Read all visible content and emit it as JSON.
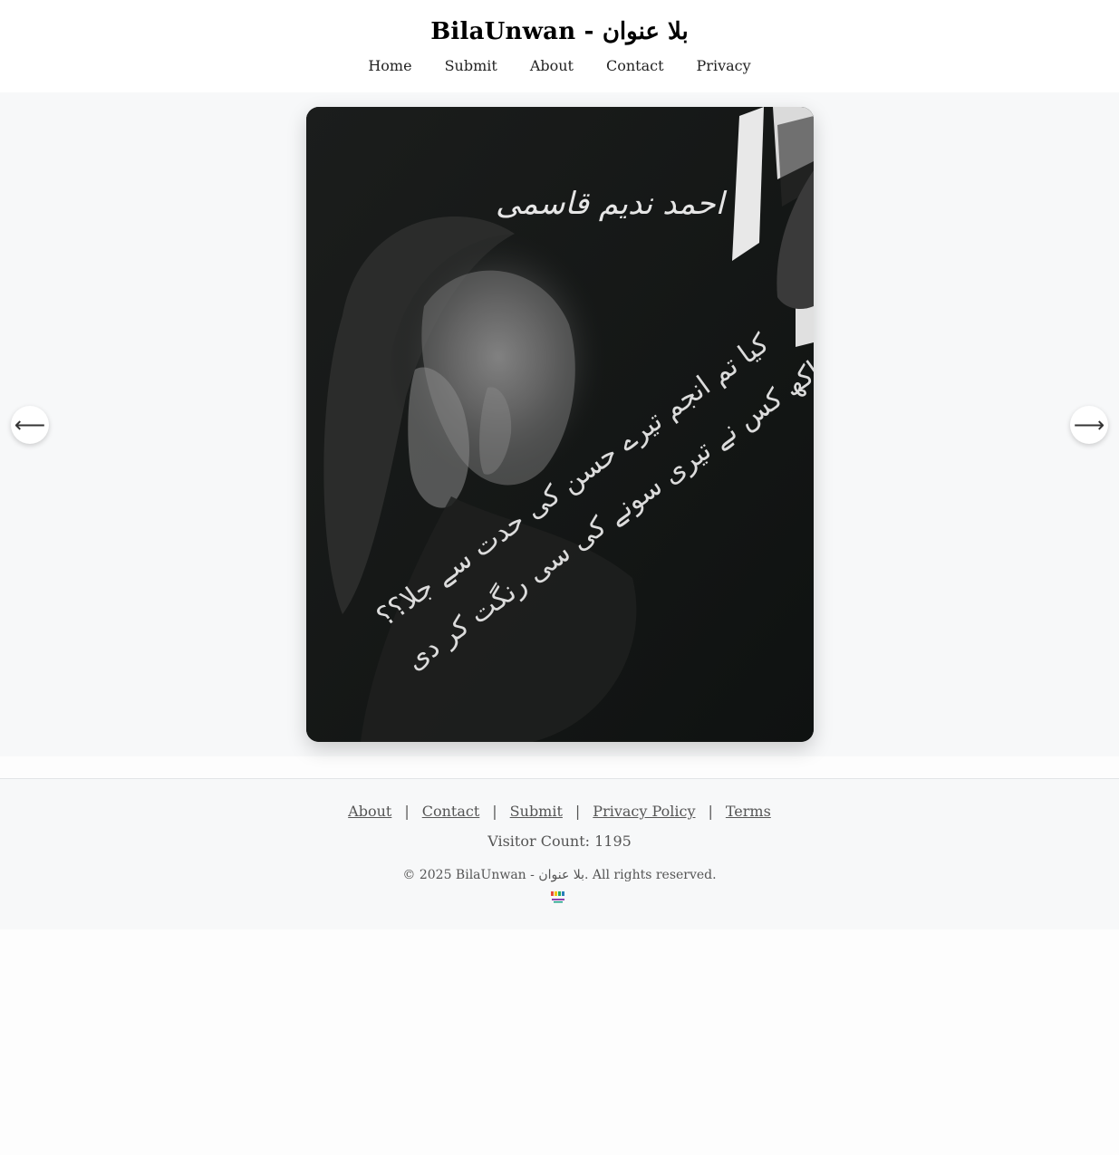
{
  "header": {
    "title": "BilaUnwan - بلا عنوان",
    "nav": [
      "Home",
      "Submit",
      "About",
      "Contact",
      "Privacy"
    ]
  },
  "slide": {
    "poet": "احمد ندیم قاسمی",
    "verse_line_1": "کیا تم انجم تیرے حسن کی حدت سے جلا؟؟",
    "verse_line_2": "راکھ کس نے تیری سونے کی سی رنگت کر دی"
  },
  "gallery_nav": {
    "prev_icon": "⟵",
    "next_icon": "⟶"
  },
  "footer": {
    "links": [
      "About",
      "Contact",
      "Submit",
      "Privacy Policy",
      "Terms"
    ],
    "separator": "|",
    "visitor_count": "Visitor Count: 1195",
    "copyright": "© 2025 BilaUnwan - بلا عنوان. All rights reserved."
  },
  "colors": {
    "page_bg": "#fdfdfd",
    "gallery_bg": "#f7f8f9",
    "card_bg": "#121514",
    "verse_text": "#dcdcdc"
  }
}
